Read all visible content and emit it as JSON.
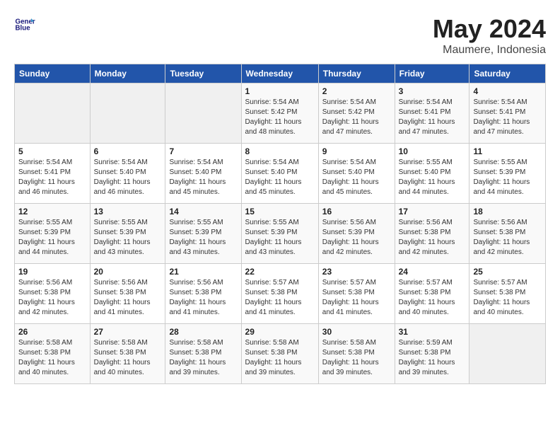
{
  "header": {
    "logo_line1": "General",
    "logo_line2": "Blue",
    "month": "May 2024",
    "location": "Maumere, Indonesia"
  },
  "weekdays": [
    "Sunday",
    "Monday",
    "Tuesday",
    "Wednesday",
    "Thursday",
    "Friday",
    "Saturday"
  ],
  "weeks": [
    [
      {
        "day": "",
        "info": ""
      },
      {
        "day": "",
        "info": ""
      },
      {
        "day": "",
        "info": ""
      },
      {
        "day": "1",
        "info": "Sunrise: 5:54 AM\nSunset: 5:42 PM\nDaylight: 11 hours\nand 48 minutes."
      },
      {
        "day": "2",
        "info": "Sunrise: 5:54 AM\nSunset: 5:42 PM\nDaylight: 11 hours\nand 47 minutes."
      },
      {
        "day": "3",
        "info": "Sunrise: 5:54 AM\nSunset: 5:41 PM\nDaylight: 11 hours\nand 47 minutes."
      },
      {
        "day": "4",
        "info": "Sunrise: 5:54 AM\nSunset: 5:41 PM\nDaylight: 11 hours\nand 47 minutes."
      }
    ],
    [
      {
        "day": "5",
        "info": "Sunrise: 5:54 AM\nSunset: 5:41 PM\nDaylight: 11 hours\nand 46 minutes."
      },
      {
        "day": "6",
        "info": "Sunrise: 5:54 AM\nSunset: 5:40 PM\nDaylight: 11 hours\nand 46 minutes."
      },
      {
        "day": "7",
        "info": "Sunrise: 5:54 AM\nSunset: 5:40 PM\nDaylight: 11 hours\nand 45 minutes."
      },
      {
        "day": "8",
        "info": "Sunrise: 5:54 AM\nSunset: 5:40 PM\nDaylight: 11 hours\nand 45 minutes."
      },
      {
        "day": "9",
        "info": "Sunrise: 5:54 AM\nSunset: 5:40 PM\nDaylight: 11 hours\nand 45 minutes."
      },
      {
        "day": "10",
        "info": "Sunrise: 5:55 AM\nSunset: 5:40 PM\nDaylight: 11 hours\nand 44 minutes."
      },
      {
        "day": "11",
        "info": "Sunrise: 5:55 AM\nSunset: 5:39 PM\nDaylight: 11 hours\nand 44 minutes."
      }
    ],
    [
      {
        "day": "12",
        "info": "Sunrise: 5:55 AM\nSunset: 5:39 PM\nDaylight: 11 hours\nand 44 minutes."
      },
      {
        "day": "13",
        "info": "Sunrise: 5:55 AM\nSunset: 5:39 PM\nDaylight: 11 hours\nand 43 minutes."
      },
      {
        "day": "14",
        "info": "Sunrise: 5:55 AM\nSunset: 5:39 PM\nDaylight: 11 hours\nand 43 minutes."
      },
      {
        "day": "15",
        "info": "Sunrise: 5:55 AM\nSunset: 5:39 PM\nDaylight: 11 hours\nand 43 minutes."
      },
      {
        "day": "16",
        "info": "Sunrise: 5:56 AM\nSunset: 5:39 PM\nDaylight: 11 hours\nand 42 minutes."
      },
      {
        "day": "17",
        "info": "Sunrise: 5:56 AM\nSunset: 5:38 PM\nDaylight: 11 hours\nand 42 minutes."
      },
      {
        "day": "18",
        "info": "Sunrise: 5:56 AM\nSunset: 5:38 PM\nDaylight: 11 hours\nand 42 minutes."
      }
    ],
    [
      {
        "day": "19",
        "info": "Sunrise: 5:56 AM\nSunset: 5:38 PM\nDaylight: 11 hours\nand 42 minutes."
      },
      {
        "day": "20",
        "info": "Sunrise: 5:56 AM\nSunset: 5:38 PM\nDaylight: 11 hours\nand 41 minutes."
      },
      {
        "day": "21",
        "info": "Sunrise: 5:56 AM\nSunset: 5:38 PM\nDaylight: 11 hours\nand 41 minutes."
      },
      {
        "day": "22",
        "info": "Sunrise: 5:57 AM\nSunset: 5:38 PM\nDaylight: 11 hours\nand 41 minutes."
      },
      {
        "day": "23",
        "info": "Sunrise: 5:57 AM\nSunset: 5:38 PM\nDaylight: 11 hours\nand 41 minutes."
      },
      {
        "day": "24",
        "info": "Sunrise: 5:57 AM\nSunset: 5:38 PM\nDaylight: 11 hours\nand 40 minutes."
      },
      {
        "day": "25",
        "info": "Sunrise: 5:57 AM\nSunset: 5:38 PM\nDaylight: 11 hours\nand 40 minutes."
      }
    ],
    [
      {
        "day": "26",
        "info": "Sunrise: 5:58 AM\nSunset: 5:38 PM\nDaylight: 11 hours\nand 40 minutes."
      },
      {
        "day": "27",
        "info": "Sunrise: 5:58 AM\nSunset: 5:38 PM\nDaylight: 11 hours\nand 40 minutes."
      },
      {
        "day": "28",
        "info": "Sunrise: 5:58 AM\nSunset: 5:38 PM\nDaylight: 11 hours\nand 39 minutes."
      },
      {
        "day": "29",
        "info": "Sunrise: 5:58 AM\nSunset: 5:38 PM\nDaylight: 11 hours\nand 39 minutes."
      },
      {
        "day": "30",
        "info": "Sunrise: 5:58 AM\nSunset: 5:38 PM\nDaylight: 11 hours\nand 39 minutes."
      },
      {
        "day": "31",
        "info": "Sunrise: 5:59 AM\nSunset: 5:38 PM\nDaylight: 11 hours\nand 39 minutes."
      },
      {
        "day": "",
        "info": ""
      }
    ]
  ]
}
